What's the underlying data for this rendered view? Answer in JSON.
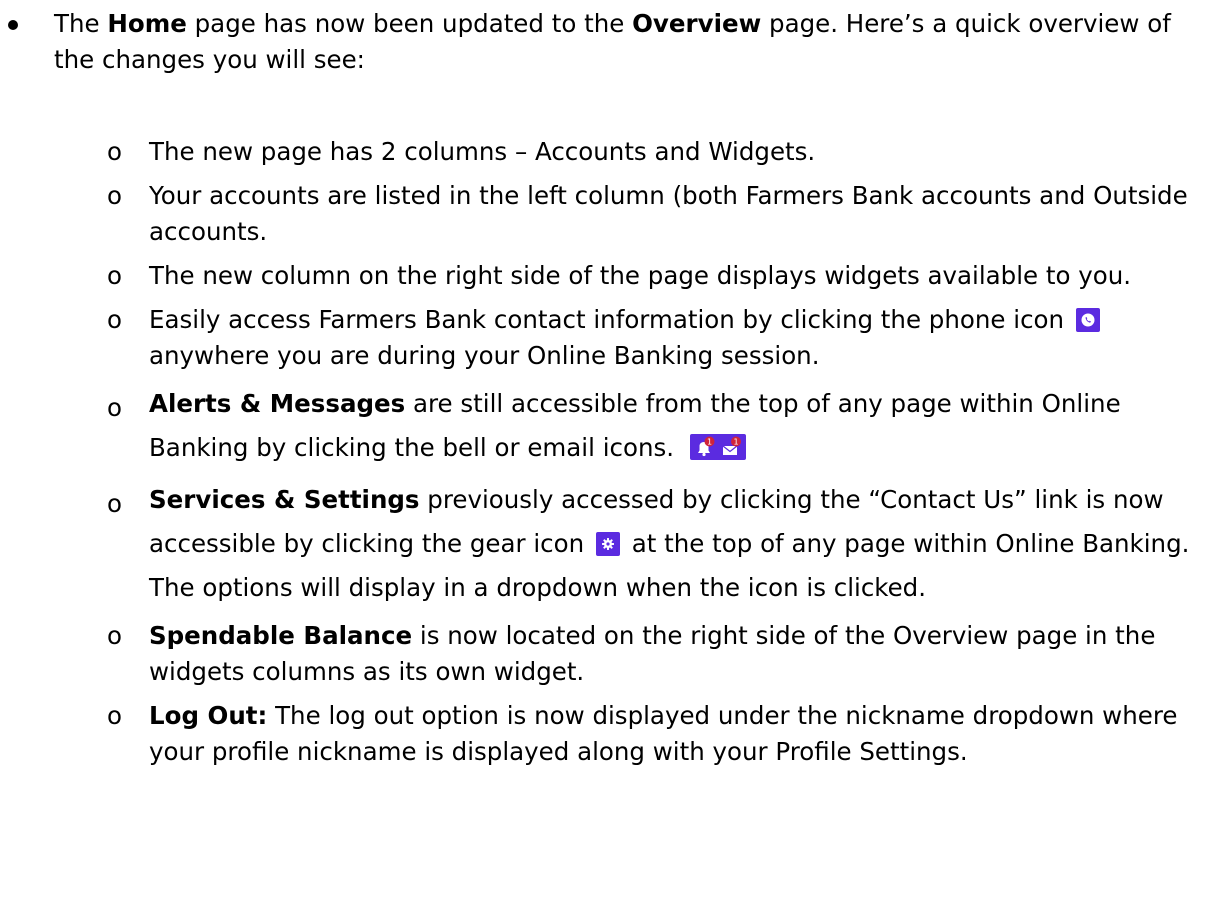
{
  "intro": {
    "part1": "The ",
    "bold1": "Home",
    "part2": " page has now been updated to the ",
    "bold2": "Overview",
    "part3": " page. Here’s a quick overview of the changes you will see:"
  },
  "marker": "o",
  "items": [
    {
      "text": "The new page has 2 columns – Accounts and Widgets."
    },
    {
      "text": "Your accounts are listed in the left column (both Farmers Bank accounts and Outside accounts."
    },
    {
      "text": "The new column on the right side of the page displays widgets available to you."
    },
    {
      "before": "Easily access Farmers Bank contact information by clicking the phone icon",
      "after": "anywhere you are during your Online Banking session.",
      "icon": "phone-icon"
    },
    {
      "bold": "Alerts & Messages",
      "text": " are still accessible from the top of any page within Online Banking by clicking the bell or email icons.",
      "icons": [
        "bell-icon",
        "email-icon"
      ]
    },
    {
      "bold": "Services & Settings",
      "before": " previously accessed by clicking the “Contact Us” link is now accessible by clicking the gear icon",
      "after": "at the top of any page within Online Banking.  The options will display in a dropdown when the icon is clicked.",
      "icon": "gear-icon"
    },
    {
      "bold": "Spendable Balance",
      "text": " is now located on the right side of the Overview page in the widgets columns as its own widget."
    },
    {
      "bold": "Log Out:",
      "text": "  The log out option is now displayed under the nickname dropdown where your profile nickname is displayed along with your Profile Settings."
    }
  ],
  "badge": "1",
  "colors": {
    "icon_bg": "#5b2be0",
    "badge": "#d0233a"
  }
}
